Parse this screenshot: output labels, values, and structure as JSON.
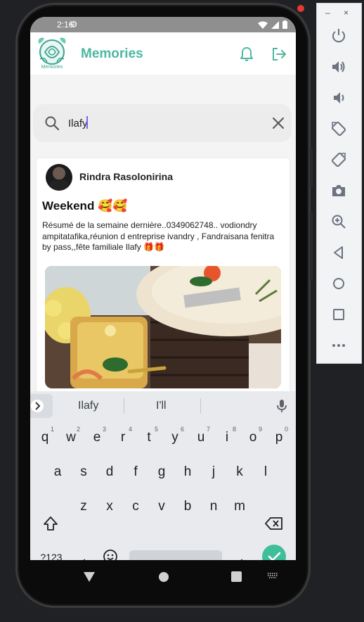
{
  "status_bar": {
    "time": "2:16",
    "wifi_icon": "wifi-icon",
    "signal_icon": "signal-icon",
    "battery_icon": "battery-icon"
  },
  "app": {
    "title": "Memories",
    "logo_text": "Memories",
    "accent": "#4cb8a0"
  },
  "search": {
    "value": "Ilafy",
    "placeholder": ""
  },
  "post": {
    "author": "Rindra Rasolonirina",
    "title": "Weekend 🥰🥰",
    "body": "Résumé de la semaine dernière..0349062748.. vodiondry ampitatafika,réunion d entreprise ivandry , Fandraisana fenitra by pass,,fête familiale Ilafy 🎁🎁"
  },
  "keyboard": {
    "suggestions": [
      "Ilafy",
      "I'll"
    ],
    "row1": [
      {
        "k": "q",
        "n": "1"
      },
      {
        "k": "w",
        "n": "2"
      },
      {
        "k": "e",
        "n": "3"
      },
      {
        "k": "r",
        "n": "4"
      },
      {
        "k": "t",
        "n": "5"
      },
      {
        "k": "y",
        "n": "6"
      },
      {
        "k": "u",
        "n": "7"
      },
      {
        "k": "i",
        "n": "8"
      },
      {
        "k": "o",
        "n": "9"
      },
      {
        "k": "p",
        "n": "0"
      }
    ],
    "row2": [
      "a",
      "s",
      "d",
      "f",
      "g",
      "h",
      "j",
      "k",
      "l"
    ],
    "row3": [
      "z",
      "x",
      "c",
      "v",
      "b",
      "n",
      "m"
    ],
    "symbols_label": "?123",
    "comma": ",",
    "period": "."
  },
  "toolbar": {
    "window_min": "–",
    "window_close": "×",
    "buttons": [
      "power-icon",
      "volume-up-icon",
      "volume-down-icon",
      "rotate-left-icon",
      "rotate-right-icon",
      "camera-icon",
      "zoom-icon",
      "back-icon",
      "home-icon",
      "overview-icon",
      "more-icon"
    ]
  }
}
